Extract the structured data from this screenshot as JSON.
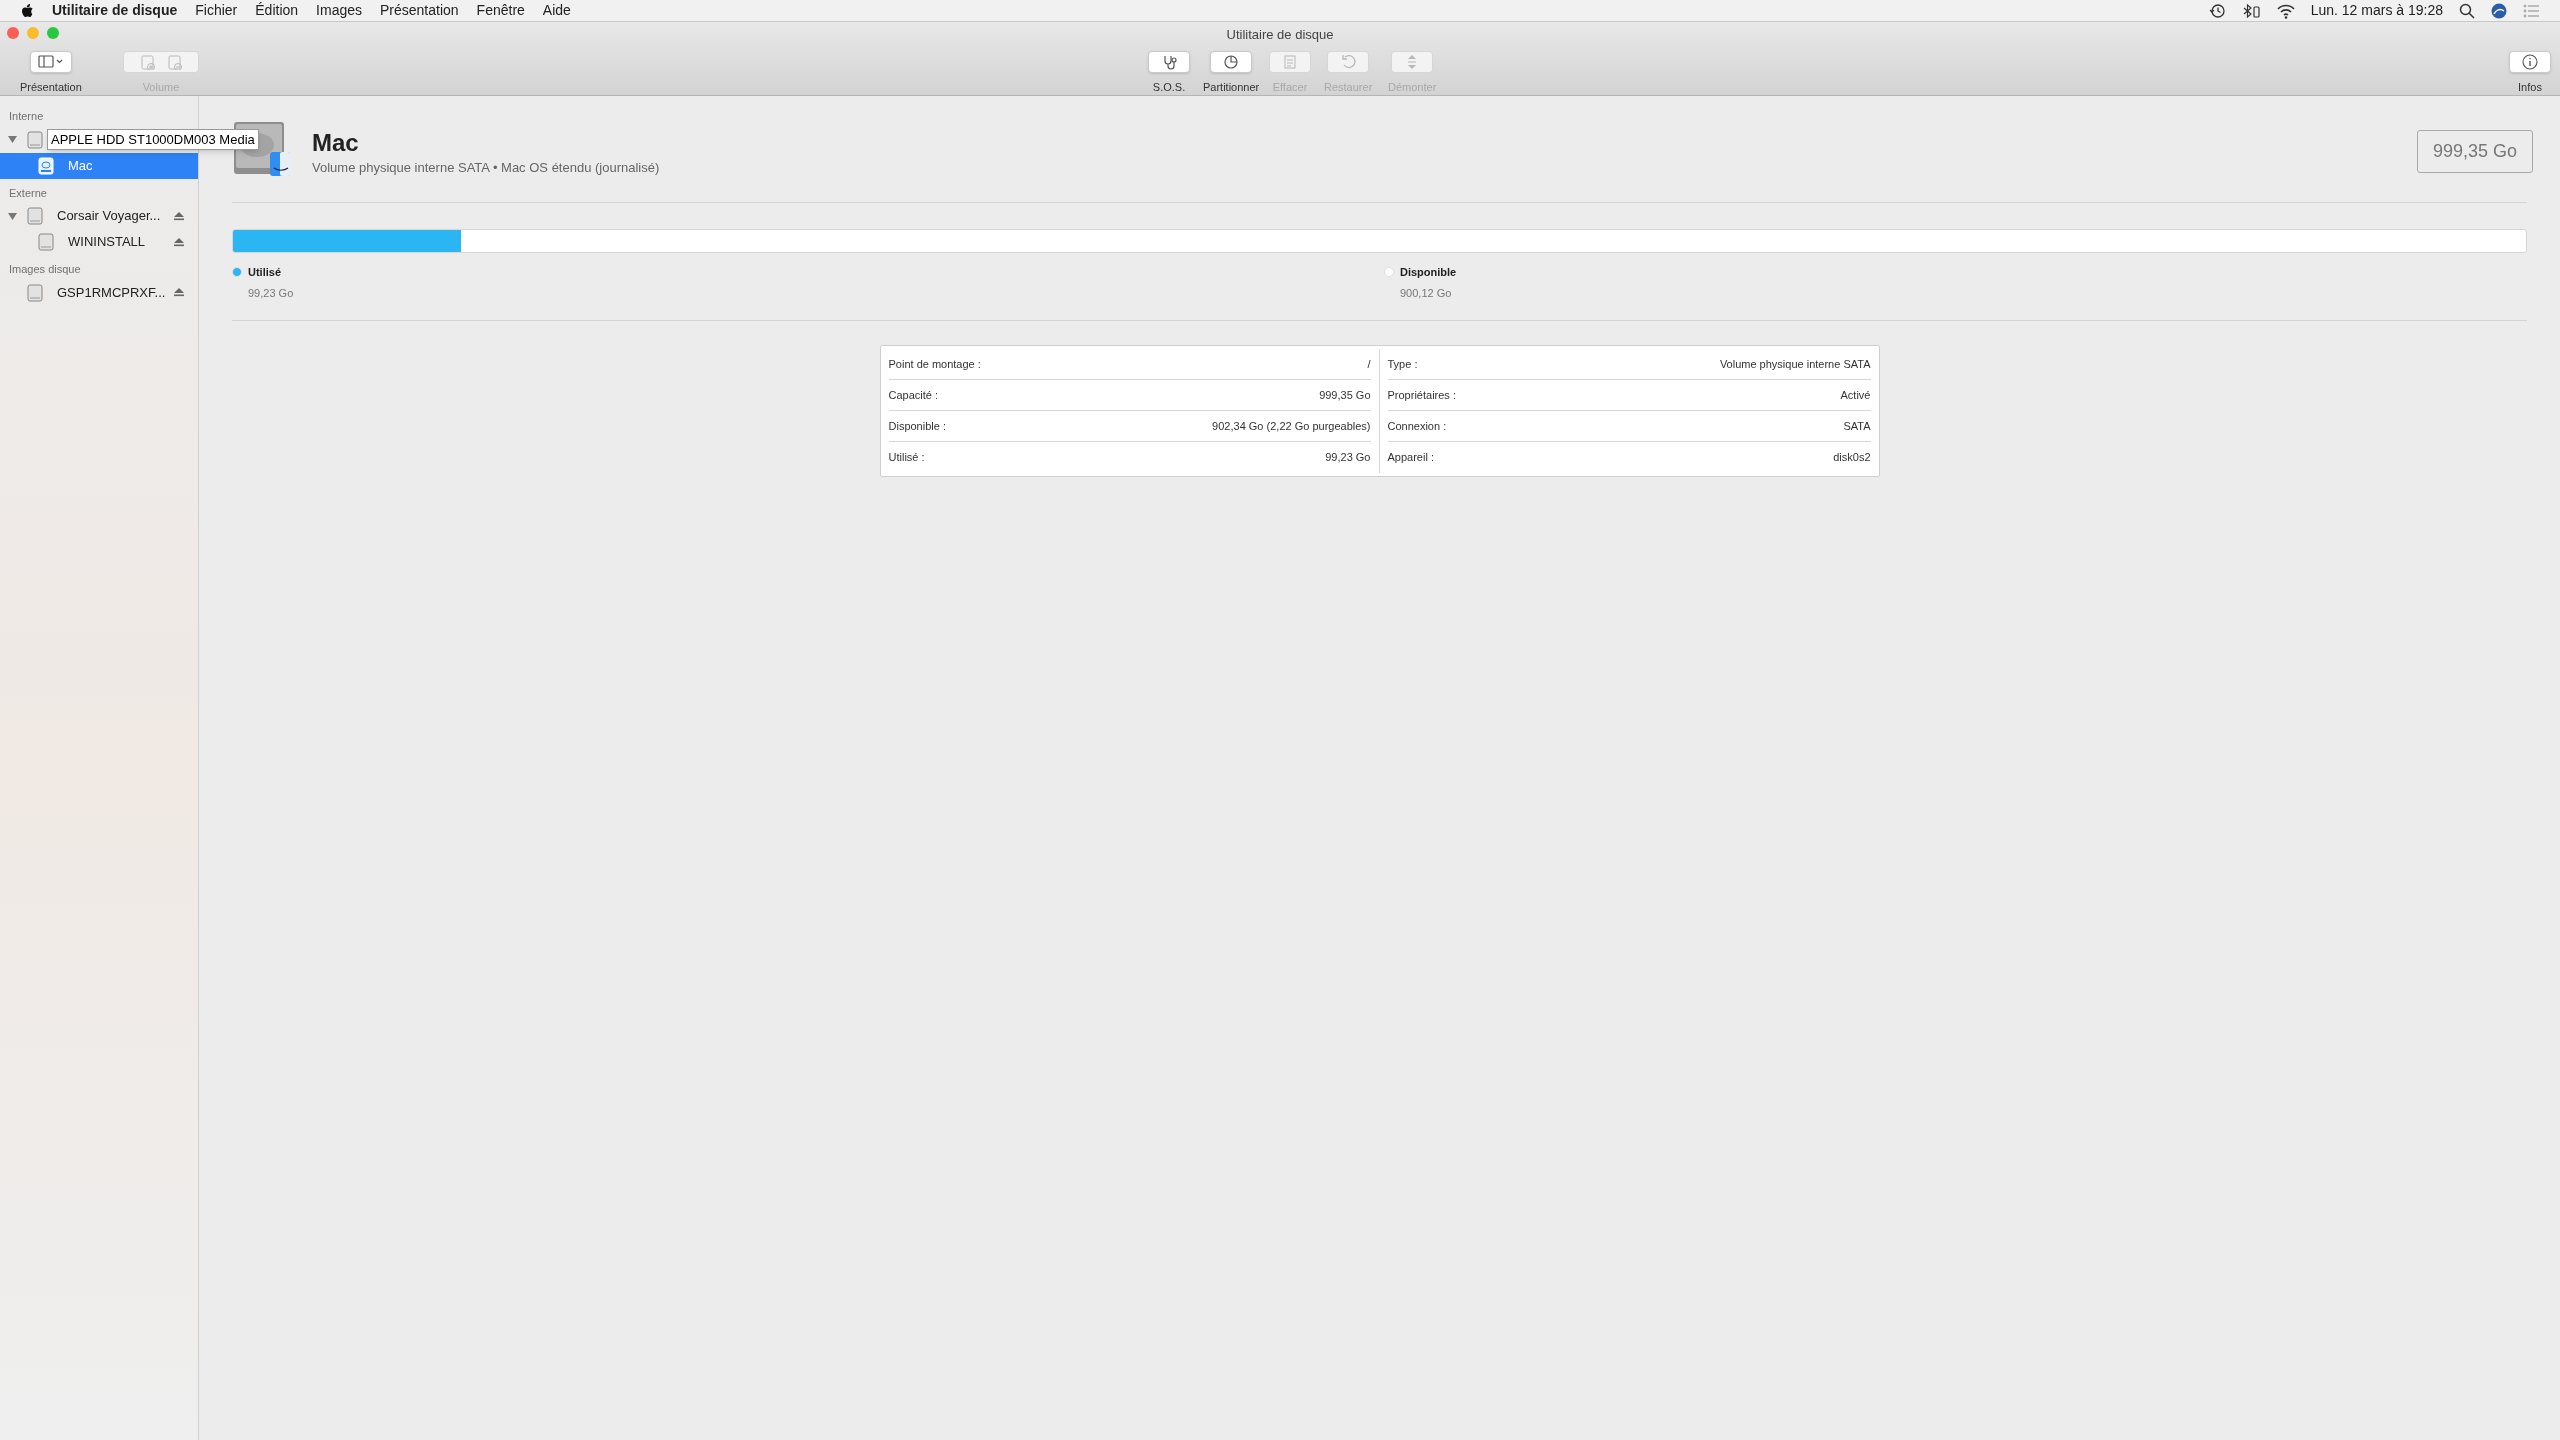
{
  "menu_bar": {
    "app": "Utilitaire de disque",
    "menus": [
      "Fichier",
      "Édition",
      "Images",
      "Présentation",
      "Fenêtre",
      "Aide"
    ],
    "clock": "Lun. 12 mars à 19:28"
  },
  "window": {
    "title": "Utilitaire de disque"
  },
  "toolbar": {
    "left": [
      {
        "kind": "view",
        "label": "Présentation",
        "disabled": false
      },
      {
        "kind": "volume",
        "label": "Volume",
        "disabled": true
      }
    ],
    "center": [
      {
        "kind": "sos",
        "label": "S.O.S.",
        "disabled": false
      },
      {
        "kind": "partition",
        "label": "Partitionner",
        "disabled": false
      },
      {
        "kind": "erase",
        "label": "Effacer",
        "disabled": true
      },
      {
        "kind": "restore",
        "label": "Restaurer",
        "disabled": true
      },
      {
        "kind": "unmount",
        "label": "Démonter",
        "disabled": true
      }
    ],
    "right": [
      {
        "kind": "info",
        "label": "Infos",
        "disabled": false
      }
    ]
  },
  "sidebar": {
    "sections": [
      {
        "title": "Interne",
        "items": [
          {
            "label": "APPLE HDD ST1000DM003 Media",
            "tooltip": true,
            "expanded": true,
            "selected": false,
            "children": [
              {
                "label": "Mac",
                "tooltip": false,
                "selected": true
              }
            ]
          }
        ]
      },
      {
        "title": "Externe",
        "items": [
          {
            "label": "Corsair Voyager...",
            "tooltip": false,
            "expanded": true,
            "selected": false,
            "ejectable": true,
            "children": [
              {
                "label": "WININSTALL",
                "tooltip": false,
                "selected": false,
                "ejectable": true
              }
            ]
          }
        ]
      },
      {
        "title": "Images disque",
        "items": [
          {
            "label": "GSP1RMCPRXF...",
            "tooltip": false,
            "selected": false,
            "ejectable": true
          }
        ]
      }
    ]
  },
  "volume": {
    "name": "Mac",
    "description": "Volume physique interne SATA • Mac OS étendu (journalisé)",
    "capacity": "999,35 Go"
  },
  "usage": {
    "level": 0.0993,
    "legend": [
      {
        "label": "Utilisé",
        "value": "99,23 Go",
        "color": "#2bb5f2"
      },
      {
        "label": "Disponible",
        "value": "900,12 Go",
        "color": "#ffffff"
      }
    ]
  },
  "info_table": {
    "left": [
      {
        "label": "Point de montage :",
        "value": "/"
      },
      {
        "label": "Capacité :",
        "value": "999,35 Go"
      },
      {
        "label": "Disponible :",
        "value": "902,34 Go (2,22 Go purgeables)"
      },
      {
        "label": "Utilisé :",
        "value": "99,23 Go"
      }
    ],
    "right": [
      {
        "label": "Type :",
        "value": "Volume physique interne SATA"
      },
      {
        "label": "Propriétaires :",
        "value": "Activé"
      },
      {
        "label": "Connexion :",
        "value": "SATA"
      },
      {
        "label": "Appareil :",
        "value": "disk0s2"
      }
    ]
  }
}
